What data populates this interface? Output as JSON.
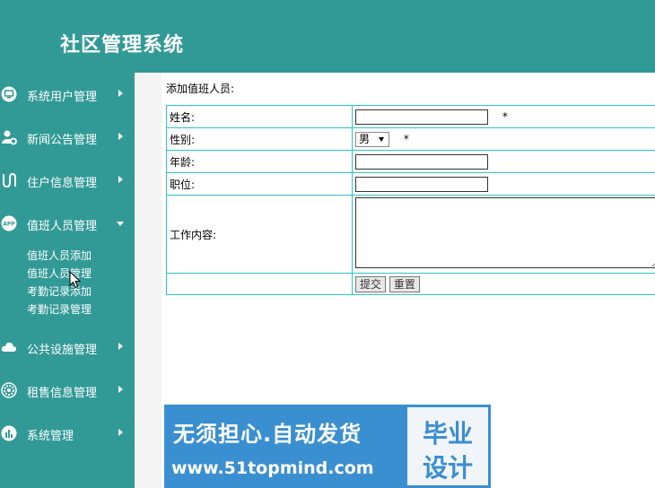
{
  "app": {
    "title": "社区管理系统"
  },
  "sidebar": {
    "items": [
      {
        "label": "系统用户管理",
        "icon": "monitor-icon"
      },
      {
        "label": "新闻公告管理",
        "icon": "user-gear-icon"
      },
      {
        "label": "住户信息管理",
        "icon": "route-icon"
      },
      {
        "label": "值班人员管理",
        "icon": "app-icon",
        "expanded": true,
        "children": [
          "值班人员添加",
          "值班人员管理",
          "考勤记录添加",
          "考勤记录管理"
        ]
      },
      {
        "label": "公共设施管理",
        "icon": "cloud-icon"
      },
      {
        "label": "租售信息管理",
        "icon": "settings-circle-icon"
      },
      {
        "label": "系统管理",
        "icon": "bar-chart-icon"
      }
    ]
  },
  "form": {
    "title": "添加值班人员:",
    "name_label": "姓名:",
    "name_value": "",
    "required_mark": "*",
    "gender_label": "性别:",
    "gender_selected": "男",
    "age_label": "年龄:",
    "age_value": "",
    "position_label": "职位:",
    "position_value": "",
    "work_label": "工作内容:",
    "work_value": "",
    "submit_label": "提交",
    "reset_label": "重置"
  },
  "ad": {
    "line1": "无须担心.自动发货",
    "line2": "www.51topmind.com",
    "badge_top": "毕业",
    "badge_bottom": "设计"
  },
  "colors": {
    "primary": "#329a96",
    "table_border": "#2ec4c4",
    "ad_blue": "#3a8fd0"
  }
}
